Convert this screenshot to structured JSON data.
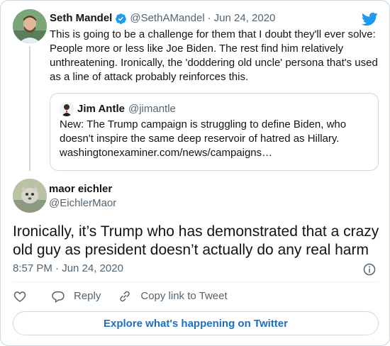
{
  "parent_tweet": {
    "name": "Seth Mandel",
    "handle": "@SethAMandel",
    "separator": "·",
    "date": "Jun 24, 2020",
    "text": "This is going to be a challenge for them that I doubt they'll ever solve: People more or less like Joe Biden. The rest find him relatively unthreatening. Ironically, the 'doddering old uncle' persona that's used as a line of attack probably reinforces this."
  },
  "quoted_tweet": {
    "name": "Jim Antle",
    "handle": "@jimantle",
    "text": "New: The Trump campaign is struggling to define Biden, who doesn't inspire the same deep reservoir of hatred as Hillary.",
    "link": "washingtonexaminer.com/news/campaigns…"
  },
  "main_tweet": {
    "name": "maor eichler",
    "handle": "@EichlerMaor",
    "text": "Ironically, it’s Trump who has demonstrated that a crazy old guy as president doesn’t actually do any real harm",
    "timestamp": "8:57 PM · Jun 24, 2020"
  },
  "actions": {
    "reply": "Reply",
    "copy_link": "Copy link to Tweet"
  },
  "explore": "Explore what's happening on Twitter",
  "colors": {
    "twitter_blue": "#1d9bf0",
    "link_blue": "#1d6fbf",
    "muted": "#536471",
    "border": "#cfd9de"
  },
  "icons": [
    "verified-badge-icon",
    "twitter-bird-icon",
    "info-icon",
    "heart-icon",
    "reply-icon",
    "copy-link-icon"
  ]
}
